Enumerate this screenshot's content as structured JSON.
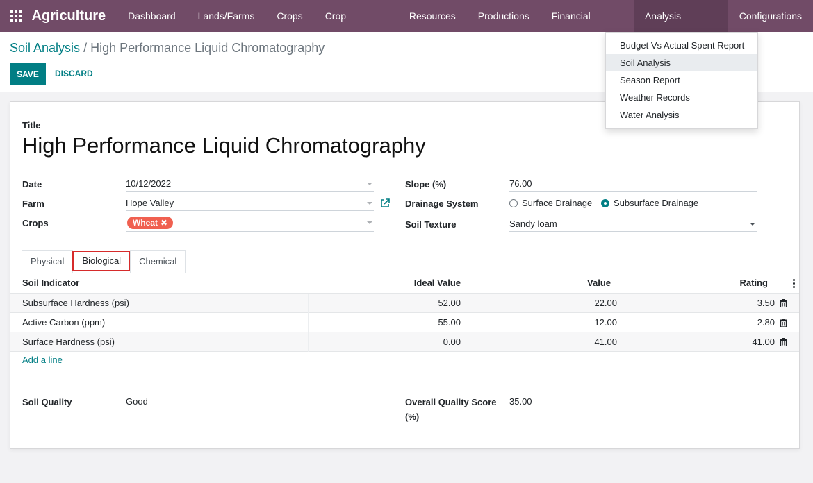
{
  "navbar": {
    "brand": "Agriculture",
    "menu": [
      "Dashboard",
      "Lands/Farms",
      "Crops",
      "Crop Incidents",
      "Resources",
      "Productions",
      "Financial History",
      "Analysis Reports",
      "Configurations"
    ]
  },
  "breadcrumb": {
    "parent": "Soil Analysis",
    "separator": "/",
    "current": "High Performance Liquid Chromatography"
  },
  "buttons": {
    "save": "Save",
    "discard": "Discard"
  },
  "form": {
    "title_label": "Title",
    "title_value": "High Performance Liquid Chromatography",
    "date_label": "Date",
    "date_value": "10/12/2022",
    "farm_label": "Farm",
    "farm_value": "Hope Valley",
    "crops_label": "Crops",
    "crops_tag": "Wheat",
    "slope_label": "Slope (%)",
    "slope_value": "76.00",
    "drainage_label": "Drainage System",
    "drainage_options": [
      "Surface Drainage",
      "Subsurface Drainage"
    ],
    "drainage_selected": "Subsurface Drainage",
    "texture_label": "Soil Texture",
    "texture_value": "Sandy loam",
    "quality_label": "Soil Quality",
    "quality_value": "Good",
    "score_label_line1": "Overall Quality Score",
    "score_label_line2": "(%)",
    "score_value": "35.00"
  },
  "tabs": [
    "Physical",
    "Biological",
    "Chemical"
  ],
  "active_tab": "Biological",
  "table": {
    "headers": [
      "Soil Indicator",
      "Ideal Value",
      "Value",
      "Rating"
    ],
    "rows": [
      [
        "Subsurface Hardness (psi)",
        "52.00",
        "22.00",
        "3.50"
      ],
      [
        "Active Carbon (ppm)",
        "55.00",
        "12.00",
        "2.80"
      ],
      [
        "Surface Hardness (psi)",
        "0.00",
        "41.00",
        "41.00"
      ]
    ],
    "add_line": "Add a line"
  },
  "dropdown": {
    "items": [
      "Budget Vs Actual Spent Report",
      "Soil Analysis",
      "Season Report",
      "Weather Records",
      "Water Analysis"
    ],
    "hovered": "Soil Analysis"
  },
  "colors": {
    "navbar": "#714b67",
    "primary": "#017e84",
    "tag": "#f06050",
    "tab_highlight": "#d62b2b"
  }
}
